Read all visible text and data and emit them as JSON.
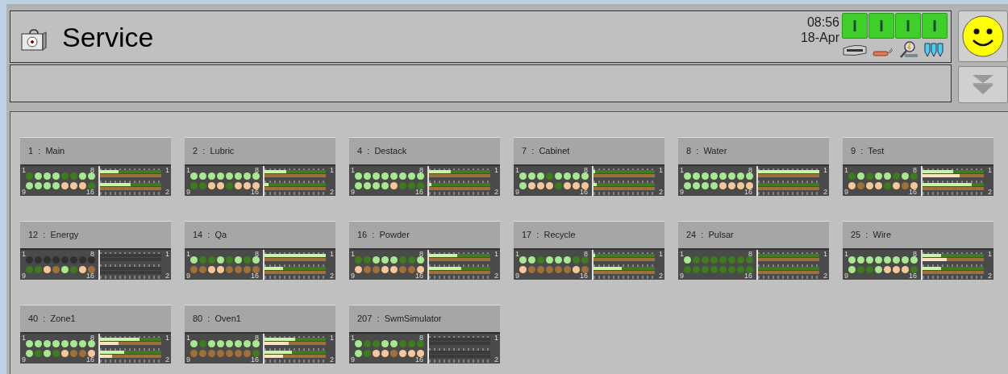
{
  "header": {
    "title": "Service",
    "time": "08:56",
    "date": "18-Apr",
    "status_buttons": [
      "I",
      "I",
      "I",
      "I"
    ]
  },
  "tiles": [
    {
      "title": "1  :  Main",
      "active": true,
      "corner_labels": [
        "1",
        "8",
        "9",
        "16"
      ],
      "channel_labels": [
        "1",
        "2"
      ],
      "dots": [
        {
          "color": "#3e7a1e"
        },
        {
          "color": "#a8e890"
        },
        {
          "color": "#a8e890"
        },
        {
          "color": "#a8e890"
        },
        {
          "color": "#3e7a1e"
        },
        {
          "color": "#3e7a1e"
        },
        {
          "color": "#a8e890"
        },
        {
          "color": "#a8e890"
        },
        {
          "color": "#a8e890"
        },
        {
          "color": "#a8e890"
        },
        {
          "color": "#a8e890"
        },
        {
          "color": "#a8e890"
        },
        {
          "color": "#f8c89a"
        },
        {
          "color": "#f8c89a"
        },
        {
          "color": "#f8c89a"
        },
        {
          "color": "#3e7a1e"
        }
      ],
      "bars": [
        {
          "level": 0.3
        },
        {
          "level": 0
        },
        {
          "level": 0.5
        },
        {
          "level": 0
        }
      ]
    },
    {
      "title": "2  :  Lubric",
      "active": true,
      "corner_labels": [
        "1",
        "8",
        "9",
        "16"
      ],
      "channel_labels": [
        "1",
        "2"
      ],
      "dots": [
        {
          "color": "#a8e890"
        },
        {
          "color": "#a8e890"
        },
        {
          "color": "#a8e890"
        },
        {
          "color": "#a8e890"
        },
        {
          "color": "#a8e890"
        },
        {
          "color": "#a8e890"
        },
        {
          "color": "#a8e890"
        },
        {
          "color": "#a8e890"
        },
        {
          "color": "#3e7a1e"
        },
        {
          "color": "#3e7a1e"
        },
        {
          "color": "#f8c89a"
        },
        {
          "color": "#f8c89a"
        },
        {
          "color": "#3e7a1e"
        },
        {
          "color": "#f8c89a"
        },
        {
          "color": "#f8c89a"
        },
        {
          "color": "#f8c89a"
        }
      ],
      "bars": [
        {
          "level": 0.36
        },
        {
          "level": 0
        },
        {
          "level": 0.07
        },
        {
          "level": 0
        }
      ]
    },
    {
      "title": "4  :  Destack",
      "active": true,
      "corner_labels": [
        "1",
        "8",
        "9",
        "16"
      ],
      "channel_labels": [
        "1",
        "2"
      ],
      "dots": [
        {
          "color": "#a8e890"
        },
        {
          "color": "#a8e890"
        },
        {
          "color": "#a8e890"
        },
        {
          "color": "#a8e890"
        },
        {
          "color": "#a8e890"
        },
        {
          "color": "#a8e890"
        },
        {
          "color": "#a8e890"
        },
        {
          "color": "#a8e890"
        },
        {
          "color": "#a8e890"
        },
        {
          "color": "#a8e890"
        },
        {
          "color": "#a8e890"
        },
        {
          "color": "#a8e890"
        },
        {
          "color": "#f8c89a"
        },
        {
          "color": "#3e7a1e"
        },
        {
          "color": "#3e7a1e"
        },
        {
          "color": "#3e7a1e"
        }
      ],
      "bars": [
        {
          "level": 0.35
        },
        {
          "level": 0
        },
        {
          "level": 0.04
        },
        {
          "level": 0
        }
      ]
    },
    {
      "title": "7  :  Cabinet",
      "active": true,
      "corner_labels": [
        "1",
        "8",
        "9",
        "16"
      ],
      "channel_labels": [
        "1",
        "2"
      ],
      "dots": [
        {
          "color": "#a8e890"
        },
        {
          "color": "#a8e890"
        },
        {
          "color": "#a8e890"
        },
        {
          "color": "#3e7a1e"
        },
        {
          "color": "#a8e890"
        },
        {
          "color": "#a8e890"
        },
        {
          "color": "#a8e890"
        },
        {
          "color": "#a8e890"
        },
        {
          "color": "#a8e890"
        },
        {
          "color": "#f8c89a"
        },
        {
          "color": "#f8c89a"
        },
        {
          "color": "#f8c89a"
        },
        {
          "color": "#3e7a1e"
        },
        {
          "color": "#f8c89a"
        },
        {
          "color": "#f8c89a"
        },
        {
          "color": "#f8c89a"
        }
      ],
      "bars": [
        {
          "level": 0.02
        },
        {
          "level": 0
        },
        {
          "level": 0.05
        },
        {
          "level": 0
        }
      ]
    },
    {
      "title": "8  :  Water",
      "active": true,
      "corner_labels": [
        "1",
        "8",
        "9",
        "16"
      ],
      "channel_labels": [
        "1",
        "2"
      ],
      "dots": [
        {
          "color": "#a8e890"
        },
        {
          "color": "#a8e890"
        },
        {
          "color": "#a8e890"
        },
        {
          "color": "#a8e890"
        },
        {
          "color": "#a8e890"
        },
        {
          "color": "#a8e890"
        },
        {
          "color": "#a8e890"
        },
        {
          "color": "#a8e890"
        },
        {
          "color": "#a8e890"
        },
        {
          "color": "#a8e890"
        },
        {
          "color": "#a8e890"
        },
        {
          "color": "#a8e890"
        },
        {
          "color": "#f8c89a"
        },
        {
          "color": "#f8c89a"
        },
        {
          "color": "#f8c89a"
        },
        {
          "color": "#f8c89a"
        }
      ],
      "bars": [
        {
          "level": 1
        },
        {
          "level": 0
        },
        {
          "level": 0
        },
        {
          "level": 0
        }
      ]
    },
    {
      "title": "9  :  Test",
      "active": true,
      "corner_labels": [
        "1",
        "8",
        "9",
        "16"
      ],
      "channel_labels": [
        "1",
        "2"
      ],
      "dots": [
        {
          "color": "#3e7a1e"
        },
        {
          "color": "#a8e890"
        },
        {
          "color": "#3e7a1e"
        },
        {
          "color": "#a8e890"
        },
        {
          "color": "#a8e890"
        },
        {
          "color": "#3e7a1e"
        },
        {
          "color": "#a8e890"
        },
        {
          "color": "#3e7a1e"
        },
        {
          "color": "#f8c89a"
        },
        {
          "color": "#a0703a"
        },
        {
          "color": "#f8c89a"
        },
        {
          "color": "#f8c89a"
        },
        {
          "color": "#3e7a1e"
        },
        {
          "color": "#f8c89a"
        },
        {
          "color": "#a0703a"
        },
        {
          "color": "#f8c89a"
        }
      ],
      "bars": [
        {
          "level": 0.5
        },
        {
          "level": 0.6
        },
        {
          "level": 0.8
        },
        {
          "level": 0
        }
      ]
    },
    {
      "title": "12  :  Energy",
      "active": false,
      "corner_labels": [
        "1",
        "8",
        "9",
        "16"
      ],
      "channel_labels": [
        "1",
        "2"
      ],
      "dots": [
        {
          "color": "#303030"
        },
        {
          "color": "#303030"
        },
        {
          "color": "#303030"
        },
        {
          "color": "#303030"
        },
        {
          "color": "#303030"
        },
        {
          "color": "#303030"
        },
        {
          "color": "#303030"
        },
        {
          "color": "#303030"
        },
        {
          "color": "#3e7a1e"
        },
        {
          "color": "#3e7a1e"
        },
        {
          "color": "#f8c89a"
        },
        {
          "color": "#a0703a"
        },
        {
          "color": "#a8e890"
        },
        {
          "color": "#3e7a1e"
        },
        {
          "color": "#f8c89a"
        },
        {
          "color": "#a0703a"
        }
      ],
      "bars": [
        {
          "level": 0
        },
        {
          "level": 0
        },
        {
          "level": 0
        },
        {
          "level": 0
        }
      ]
    },
    {
      "title": "14  :  Qa",
      "active": true,
      "corner_labels": [
        "1",
        "8",
        "9",
        "16"
      ],
      "channel_labels": [
        "1",
        "2"
      ],
      "dots": [
        {
          "color": "#a8e890"
        },
        {
          "color": "#3e7a1e"
        },
        {
          "color": "#3e7a1e"
        },
        {
          "color": "#a8e890"
        },
        {
          "color": "#3e7a1e"
        },
        {
          "color": "#a8e890"
        },
        {
          "color": "#3e7a1e"
        },
        {
          "color": "#a8e890"
        },
        {
          "color": "#a0703a"
        },
        {
          "color": "#a0703a"
        },
        {
          "color": "#f8c89a"
        },
        {
          "color": "#f8c89a"
        },
        {
          "color": "#a0703a"
        },
        {
          "color": "#a0703a"
        },
        {
          "color": "#a0703a"
        },
        {
          "color": "#a0703a"
        }
      ],
      "bars": [
        {
          "level": 1
        },
        {
          "level": 0
        },
        {
          "level": 0.3
        },
        {
          "level": 0
        }
      ]
    },
    {
      "title": "16  :  Powder",
      "active": true,
      "corner_labels": [
        "1",
        "8",
        "9",
        "16"
      ],
      "channel_labels": [
        "1",
        "2"
      ],
      "dots": [
        {
          "color": "#3e7a1e"
        },
        {
          "color": "#3e7a1e"
        },
        {
          "color": "#a8e890"
        },
        {
          "color": "#a8e890"
        },
        {
          "color": "#a8e890"
        },
        {
          "color": "#3e7a1e"
        },
        {
          "color": "#3e7a1e"
        },
        {
          "color": "#a8e890"
        },
        {
          "color": "#f8c89a"
        },
        {
          "color": "#a0703a"
        },
        {
          "color": "#a0703a"
        },
        {
          "color": "#f8c89a"
        },
        {
          "color": "#f8c89a"
        },
        {
          "color": "#a0703a"
        },
        {
          "color": "#a0703a"
        },
        {
          "color": "#f8c89a"
        }
      ],
      "bars": [
        {
          "level": 0.46
        },
        {
          "level": 0
        },
        {
          "level": 0.52
        },
        {
          "level": 0
        }
      ]
    },
    {
      "title": "17  :  Recycle",
      "active": true,
      "corner_labels": [
        "1",
        "8",
        "9",
        "16"
      ],
      "channel_labels": [
        "1",
        "2"
      ],
      "dots": [
        {
          "color": "#a8e890"
        },
        {
          "color": "#a8e890"
        },
        {
          "color": "#3e7a1e"
        },
        {
          "color": "#a8e890"
        },
        {
          "color": "#a8e890"
        },
        {
          "color": "#a8e890"
        },
        {
          "color": "#3e7a1e"
        },
        {
          "color": "#3e7a1e"
        },
        {
          "color": "#f8c89a"
        },
        {
          "color": "#a0703a"
        },
        {
          "color": "#a0703a"
        },
        {
          "color": "#a0703a"
        },
        {
          "color": "#a0703a"
        },
        {
          "color": "#a0703a"
        },
        {
          "color": "#f8c89a"
        },
        {
          "color": "#a0703a"
        }
      ],
      "bars": [
        {
          "level": 0.02
        },
        {
          "level": 0
        },
        {
          "level": 0.46
        },
        {
          "level": 0
        }
      ]
    },
    {
      "title": "24  :  Pulsar",
      "active": true,
      "corner_labels": [
        "1",
        "8",
        "9",
        "16"
      ],
      "channel_labels": [
        "1",
        "2"
      ],
      "dots": [
        {
          "color": "#a8e890"
        },
        {
          "color": "#3e7a1e"
        },
        {
          "color": "#3e7a1e"
        },
        {
          "color": "#3e7a1e"
        },
        {
          "color": "#3e7a1e"
        },
        {
          "color": "#3e7a1e"
        },
        {
          "color": "#3e7a1e"
        },
        {
          "color": "#3e7a1e"
        },
        {
          "color": "#3e7a1e"
        },
        {
          "color": "#3e7a1e"
        },
        {
          "color": "#3e7a1e"
        },
        {
          "color": "#3e7a1e"
        },
        {
          "color": "#3e7a1e"
        },
        {
          "color": "#3e7a1e"
        },
        {
          "color": "#3e7a1e"
        },
        {
          "color": "#3e7a1e"
        }
      ],
      "bars": [
        {
          "level": 0
        },
        {
          "level": 0
        },
        {
          "level": 0
        },
        {
          "level": 0
        }
      ]
    },
    {
      "title": "25  :  Wire",
      "active": true,
      "corner_labels": [
        "1",
        "8",
        "9",
        "16"
      ],
      "channel_labels": [
        "1",
        "2"
      ],
      "dots": [
        {
          "color": "#a8e890"
        },
        {
          "color": "#a8e890"
        },
        {
          "color": "#a8e890"
        },
        {
          "color": "#a8e890"
        },
        {
          "color": "#a8e890"
        },
        {
          "color": "#a8e890"
        },
        {
          "color": "#a8e890"
        },
        {
          "color": "#a8e890"
        },
        {
          "color": "#a8e890"
        },
        {
          "color": "#3e7a1e"
        },
        {
          "color": "#3e7a1e"
        },
        {
          "color": "#a8e890"
        },
        {
          "color": "#f8c89a"
        },
        {
          "color": "#f8c89a"
        },
        {
          "color": "#f8c89a"
        },
        {
          "color": "#3e7a1e"
        }
      ],
      "bars": [
        {
          "level": 0.3
        },
        {
          "level": 0.4
        },
        {
          "level": 0.3
        },
        {
          "level": 0
        }
      ]
    },
    {
      "title": "40  :  Zone1",
      "active": true,
      "corner_labels": [
        "1",
        "8",
        "9",
        "16"
      ],
      "channel_labels": [
        "1",
        "2"
      ],
      "dots": [
        {
          "color": "#a8e890"
        },
        {
          "color": "#a8e890"
        },
        {
          "color": "#a8e890"
        },
        {
          "color": "#a8e890"
        },
        {
          "color": "#a8e890"
        },
        {
          "color": "#a8e890"
        },
        {
          "color": "#a8e890"
        },
        {
          "color": "#a8e890"
        },
        {
          "color": "#a8e890"
        },
        {
          "color": "#3e7a1e"
        },
        {
          "color": "#a8e890"
        },
        {
          "color": "#3e7a1e"
        },
        {
          "color": "#f8c89a"
        },
        {
          "color": "#a0703a"
        },
        {
          "color": "#a0703a"
        },
        {
          "color": "#f8c89a"
        }
      ],
      "bars": [
        {
          "level": 0.64
        },
        {
          "level": 0.3
        },
        {
          "level": 0.4
        },
        {
          "level": 0.2
        }
      ]
    },
    {
      "title": "80  :  Oven1",
      "active": true,
      "corner_labels": [
        "1",
        "8",
        "9",
        "16"
      ],
      "channel_labels": [
        "1",
        "2"
      ],
      "dots": [
        {
          "color": "#a8e890"
        },
        {
          "color": "#3e7a1e"
        },
        {
          "color": "#a8e890"
        },
        {
          "color": "#a8e890"
        },
        {
          "color": "#a8e890"
        },
        {
          "color": "#a8e890"
        },
        {
          "color": "#a8e890"
        },
        {
          "color": "#a8e890"
        },
        {
          "color": "#a0703a"
        },
        {
          "color": "#a0703a"
        },
        {
          "color": "#a0703a"
        },
        {
          "color": "#a0703a"
        },
        {
          "color": "#a0703a"
        },
        {
          "color": "#a0703a"
        },
        {
          "color": "#a0703a"
        },
        {
          "color": "#3e7a1e"
        }
      ],
      "bars": [
        {
          "level": 0.5
        },
        {
          "level": 0.4
        },
        {
          "level": 0.45
        },
        {
          "level": 0.3
        }
      ]
    },
    {
      "title": "207  :  SwmSimulator",
      "active": false,
      "corner_labels": [
        "1",
        "8",
        "9",
        "16"
      ],
      "channel_labels": [
        "1",
        "2"
      ],
      "dots": [
        {
          "color": "#a8e890"
        },
        {
          "color": "#3e7a1e"
        },
        {
          "color": "#3e7a1e"
        },
        {
          "color": "#a8e890"
        },
        {
          "color": "#a8e890"
        },
        {
          "color": "#3e7a1e"
        },
        {
          "color": "#3e7a1e"
        },
        {
          "color": "#3e7a1e"
        },
        {
          "color": "#a8e890"
        },
        {
          "color": "#3e7a1e"
        },
        {
          "color": "#f8c89a"
        },
        {
          "color": "#f8c89a"
        },
        {
          "color": "#a0703a"
        },
        {
          "color": "#f8c89a"
        },
        {
          "color": "#f8c89a"
        },
        {
          "color": "#f8c89a"
        }
      ],
      "bars": [
        {
          "level": 0
        },
        {
          "level": 0
        },
        {
          "level": 0
        },
        {
          "level": 0
        }
      ]
    }
  ]
}
